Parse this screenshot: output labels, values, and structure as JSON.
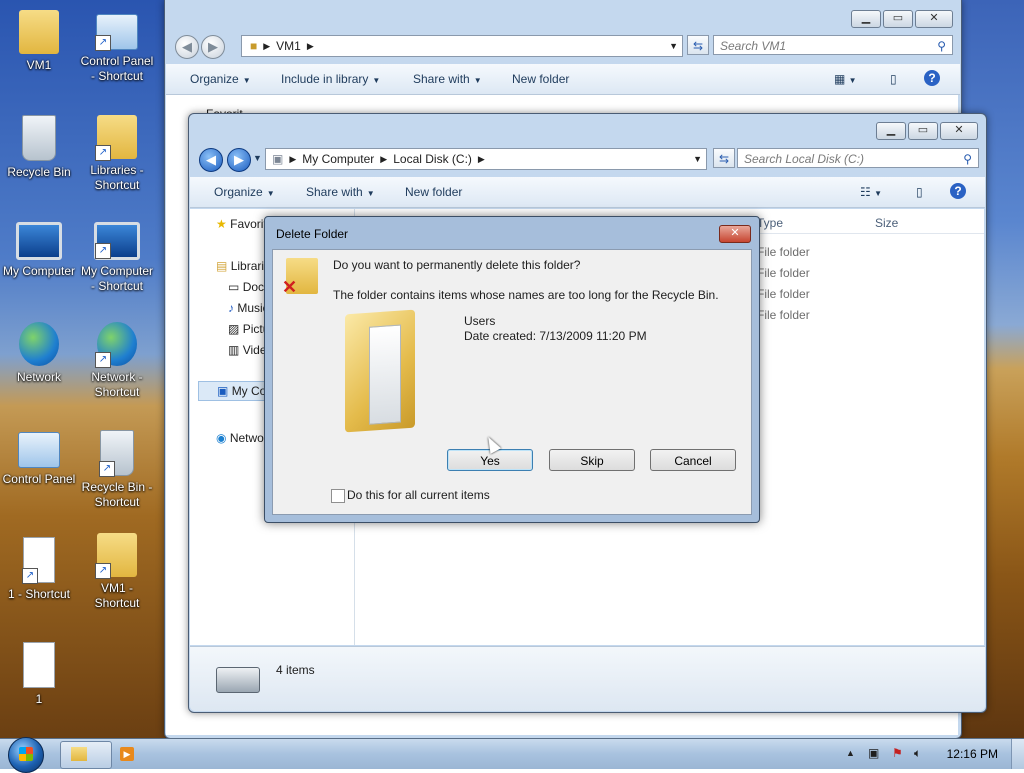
{
  "desktop": {
    "icons": [
      {
        "label": "VM1",
        "icon": "user-folder-icon"
      },
      {
        "label": "Control Panel - Shortcut",
        "icon": "control-panel-icon"
      },
      {
        "label": "Recycle Bin",
        "icon": "recycle-bin-icon"
      },
      {
        "label": "Libraries - Shortcut",
        "icon": "libraries-icon"
      },
      {
        "label": "My Computer",
        "icon": "computer-icon"
      },
      {
        "label": "My Computer - Shortcut",
        "icon": "computer-icon"
      },
      {
        "label": "Network",
        "icon": "network-icon"
      },
      {
        "label": "Network - Shortcut",
        "icon": "network-icon"
      },
      {
        "label": "Control Panel",
        "icon": "control-panel-icon"
      },
      {
        "label": "Recycle Bin - Shortcut",
        "icon": "recycle-bin-icon"
      },
      {
        "label": "1 - Shortcut",
        "icon": "document-icon"
      },
      {
        "label": "VM1 - Shortcut",
        "icon": "user-folder-icon"
      },
      {
        "label": "1",
        "icon": "document-icon"
      }
    ]
  },
  "window_back": {
    "address": "VM1",
    "search_placeholder": "Search VM1",
    "toolbar": {
      "organize": "Organize",
      "include_in_library": "Include in library",
      "share_with": "Share with",
      "new_folder": "New folder"
    },
    "nav_partial": "Favorit"
  },
  "window_front": {
    "address": [
      "My Computer",
      "Local Disk (C:)"
    ],
    "search_placeholder": "Search Local Disk (C:)",
    "toolbar": {
      "organize": "Organize",
      "share_with": "Share with",
      "new_folder": "New folder"
    },
    "nav": {
      "favorites": "Favorites",
      "libraries": "Libraries",
      "documents": "Documents",
      "music": "Music",
      "pictures": "Pictures",
      "videos": "Videos",
      "my_computer": "My Computer",
      "network": "Network"
    },
    "columns": {
      "type": "Type",
      "size": "Size"
    },
    "rows": [
      "File folder",
      "File folder",
      "File folder",
      "File folder"
    ],
    "status": "4 items"
  },
  "dialog": {
    "title": "Delete Folder",
    "question": "Do you want to permanently delete this folder?",
    "info": "The folder contains items whose names are too long for the Recycle Bin.",
    "item_name": "Users",
    "item_date": "Date created: 7/13/2009 11:20 PM",
    "buttons": {
      "yes": "Yes",
      "skip": "Skip",
      "cancel": "Cancel"
    },
    "checkbox_label": "Do this for all current items"
  },
  "taskbar": {
    "time": "12:16 PM"
  }
}
